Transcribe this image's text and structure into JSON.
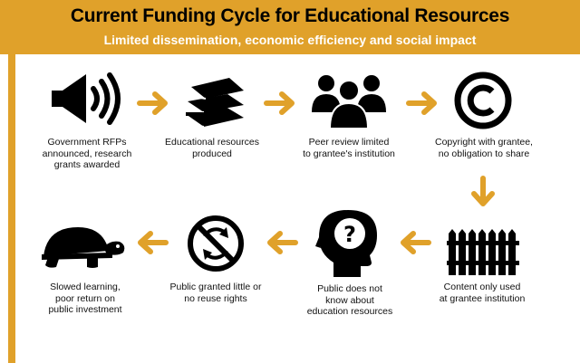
{
  "header": {
    "title": "Current Funding Cycle for Educational Resources",
    "subtitle": "Limited dissemination, economic efficiency and social impact"
  },
  "colors": {
    "accent": "#e0a12a",
    "icon": "#000000",
    "background": "#ffffff"
  },
  "steps": [
    {
      "icon": "megaphone-icon",
      "label": "Government RFPs\nannounced, research\ngrants awarded"
    },
    {
      "icon": "books-icon",
      "label": "Educational resources\nproduced"
    },
    {
      "icon": "people-icon",
      "label": "Peer review limited\nto grantee's institution"
    },
    {
      "icon": "copyright-icon",
      "label": "Copyright with grantee,\nno obligation to share"
    },
    {
      "icon": "fence-icon",
      "label": "Content only used\nat grantee institution"
    },
    {
      "icon": "head-question-icon",
      "label": "Public does not\nknow about\neducation resources"
    },
    {
      "icon": "no-recycle-icon",
      "label": "Public granted little or\nno reuse rights"
    },
    {
      "icon": "turtle-icon",
      "label": "Slowed learning,\npoor return on\npublic investment"
    }
  ]
}
